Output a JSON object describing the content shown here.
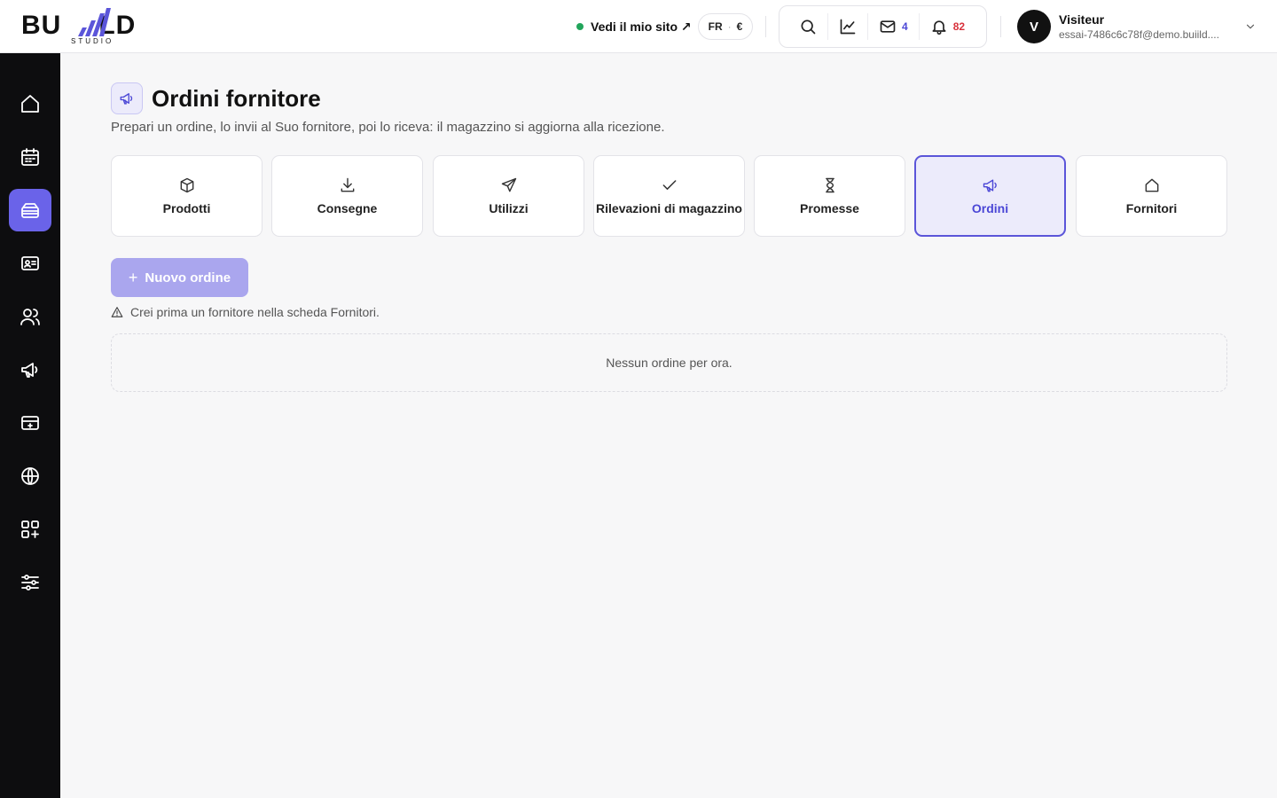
{
  "header": {
    "logo": {
      "text_left": "BU",
      "text_right": "LD",
      "sub": "STUDIO",
      "accent": "#5b55d9"
    },
    "site_link": {
      "label": "Vedi il mio sito ↗",
      "status_color": "#22a55b"
    },
    "locale": {
      "language": "FR",
      "separator": "·",
      "currency": "€"
    },
    "tools": {
      "search_icon": "search-icon",
      "stats_icon": "chart-icon",
      "messages_count": "4",
      "notifications_count": "82"
    },
    "user": {
      "initial": "V",
      "name": "Visiteur",
      "email": "essai-7486c6c78f@demo.buiild...."
    }
  },
  "sidebar": {
    "items": [
      {
        "icon": "home-icon"
      },
      {
        "icon": "calendar-icon"
      },
      {
        "icon": "inventory-icon",
        "active": true
      },
      {
        "icon": "contact-card-icon"
      },
      {
        "icon": "users-icon"
      },
      {
        "icon": "megaphone-icon"
      },
      {
        "icon": "payment-icon"
      },
      {
        "icon": "globe-icon"
      },
      {
        "icon": "apps-add-icon"
      },
      {
        "icon": "settings-sliders-icon"
      }
    ],
    "active_color": "#6a63e9"
  },
  "main": {
    "title": "Ordini fornitore",
    "subtitle": "Prepari un ordine, lo invii al Suo fornitore, poi lo riceva: il magazzino si aggiorna alla ricezione.",
    "tabs": [
      {
        "label": "Prodotti",
        "icon": "box-icon"
      },
      {
        "label": "Consegne",
        "icon": "download-icon"
      },
      {
        "label": "Utilizzi",
        "icon": "send-icon"
      },
      {
        "label": "Rilevazioni di magazzino",
        "icon": "check-icon"
      },
      {
        "label": "Promesse",
        "icon": "hourglass-icon"
      },
      {
        "label": "Ordini",
        "icon": "megaphone-icon",
        "active": true
      },
      {
        "label": "Fornitori",
        "icon": "home-icon"
      }
    ],
    "new_order_button": {
      "plus": "+",
      "label": "Nuovo ordine"
    },
    "warning": "Crei prima un fornitore nella scheda Fornitori.",
    "empty_state": "Nessun ordine per ora."
  }
}
